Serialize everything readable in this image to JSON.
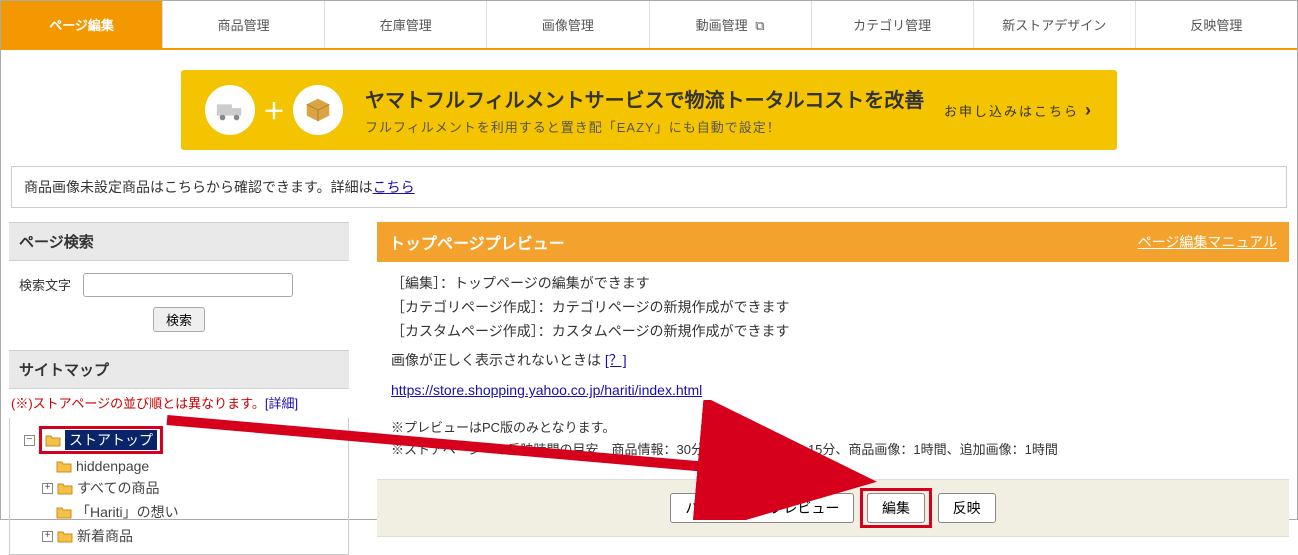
{
  "tabs": [
    {
      "label": "ページ編集",
      "active": true
    },
    {
      "label": "商品管理"
    },
    {
      "label": "在庫管理"
    },
    {
      "label": "画像管理"
    },
    {
      "label": "動画管理",
      "icon": "⧉"
    },
    {
      "label": "カテゴリ管理"
    },
    {
      "label": "新ストアデザイン"
    },
    {
      "label": "反映管理"
    }
  ],
  "banner": {
    "title": "ヤマトフルフィルメントサービスで物流トータルコストを改善",
    "sub": "フルフィルメントを利用すると置き配「EAZY」にも自動で設定！",
    "cta": "お申し込みはこちら",
    "cta_icon": "›"
  },
  "notice": {
    "text": "商品画像未設定商品はこちらから確認できます。詳細は",
    "link": "こちら"
  },
  "search": {
    "title": "ページ検索",
    "label": "検索文字",
    "button": "検索"
  },
  "sitemap": {
    "title": "サイトマップ",
    "note_prefix": "(※)ストアページの並び順とは異なります。",
    "note_link": "[詳細]",
    "items": [
      {
        "label": "ストアトップ",
        "selected": true,
        "highlighted": true,
        "toggle": "−",
        "indent": 0
      },
      {
        "label": "hiddenpage",
        "indent": 1
      },
      {
        "label": "すべての商品",
        "toggle": "+",
        "indent": 1
      },
      {
        "label": "「Hariti」の想い",
        "indent": 1
      },
      {
        "label": "新着商品",
        "toggle": "+",
        "indent": 1
      }
    ]
  },
  "preview": {
    "title": "トップページプレビュー",
    "manual_link": "ページ編集マニュアル",
    "lines": [
      "［編集］：トップページの編集ができます",
      "［カテゴリページ作成］：カテゴリページの新規作成ができます",
      "［カスタムページ作成］：カスタムページの新規作成ができます"
    ],
    "img_note_prefix": "画像が正しく表示されないときは ",
    "img_note_link": "[？]",
    "url": "https://store.shopping.yahoo.co.jp/hariti/index.html",
    "foot1": "※プレビューはPC版のみとなります。",
    "foot2": "※ストアページへの反映時間の目安　商品情報：30分、カテゴリ情報：15分、商品画像：1時間、追加画像：1時間"
  },
  "actions": {
    "preview_btn": "パソコン版でプレビュー",
    "edit_btn": "編集",
    "publish_btn": "反映"
  }
}
